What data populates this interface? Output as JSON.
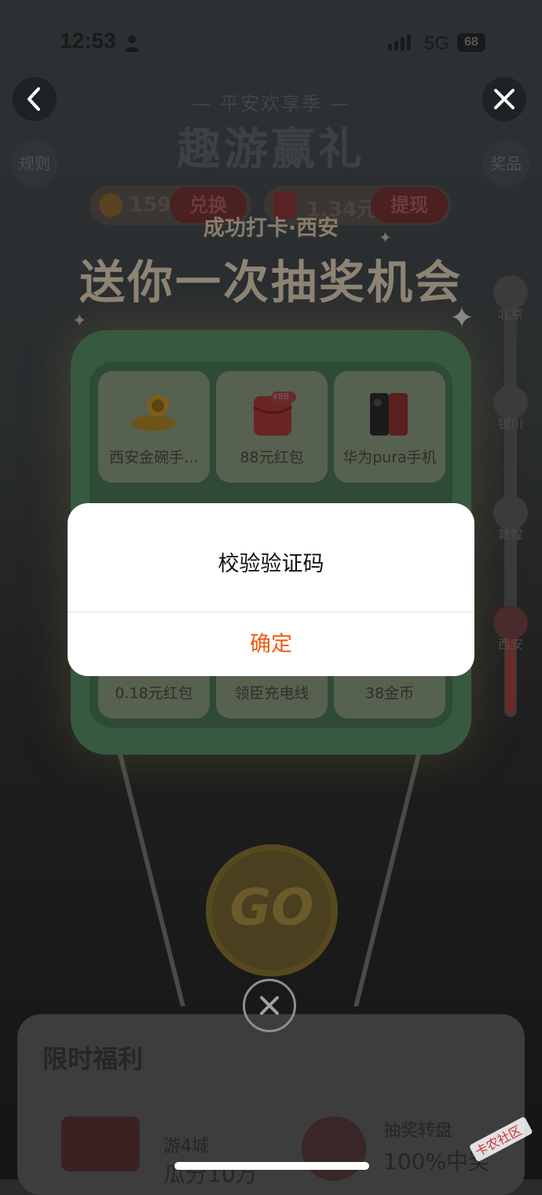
{
  "status_bar": {
    "time": "12:53",
    "network": "5G",
    "battery": "68"
  },
  "header": {
    "subtitle": "— 平安欢享季 —",
    "title": "趣游赢礼",
    "rules": "规则",
    "prizes": "奖品"
  },
  "wallet": {
    "coins": "159",
    "exchange_label": "兑换",
    "cash": "1.34元",
    "withdraw_label": "提现"
  },
  "lottery": {
    "checkin": "成功打卡·西安",
    "title": "送你一次抽奖机会",
    "prizes": [
      {
        "label": "西安金碗手…",
        "icon": "gold-bowl-icon"
      },
      {
        "label": "88元红包",
        "icon": "red-envelope-icon",
        "badge": "¥88"
      },
      {
        "label": "华为pura手机",
        "icon": "phone-icon"
      },
      {
        "label": "0.18元红包",
        "icon": "red-envelope-icon"
      },
      {
        "label": "领臣充电线",
        "icon": "cable-icon"
      },
      {
        "label": "38金币",
        "icon": "coin-icon"
      }
    ]
  },
  "route": {
    "cities": [
      "北京",
      "银川",
      "敦煌",
      "西安"
    ]
  },
  "go_button": "GO",
  "welfare": {
    "title": "限时福利",
    "task1_line1": "游4城",
    "task1_line2": "瓜分10万",
    "task2_line1": "抽奖转盘",
    "task2_line2": "100%中奖"
  },
  "dialog": {
    "title": "校验验证码",
    "confirm_label": "确定"
  },
  "watermark": "卡农社区",
  "colors": {
    "confirm": "#ef5a12",
    "dialog_bg": "#ffffff"
  }
}
